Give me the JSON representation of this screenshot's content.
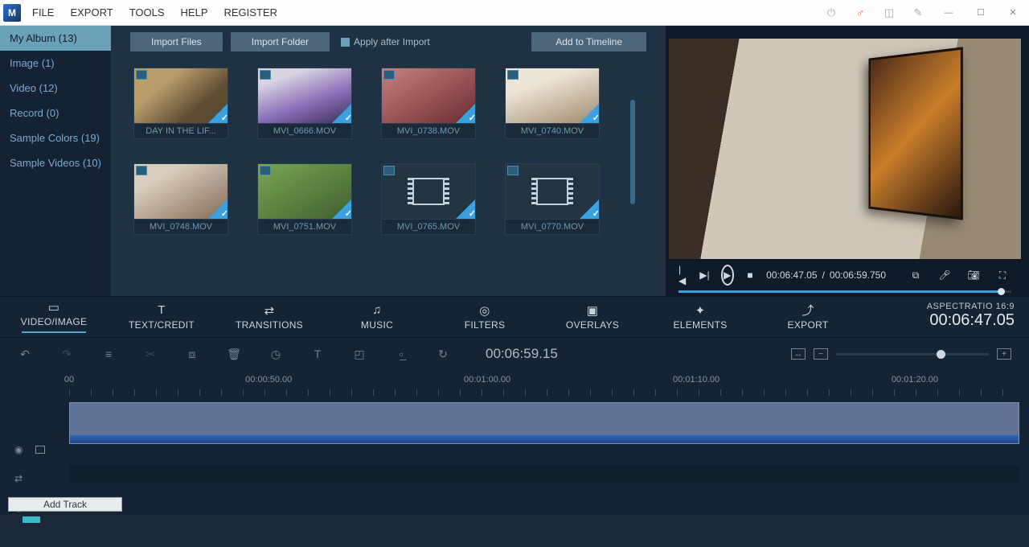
{
  "menu": {
    "file": "FILE",
    "export": "EXPORT",
    "tools": "TOOLS",
    "help": "HELP",
    "register": "REGISTER"
  },
  "sidebar": {
    "items": [
      {
        "label": "My Album (13)",
        "active": true
      },
      {
        "label": "Image (1)"
      },
      {
        "label": "Video (12)"
      },
      {
        "label": "Record (0)"
      },
      {
        "label": "Sample Colors (19)"
      },
      {
        "label": "Sample Videos (10)"
      }
    ]
  },
  "mediaToolbar": {
    "importFiles": "Import Files",
    "importFolder": "Import Folder",
    "applyAfter": "Apply after Import",
    "addTimeline": "Add to Timeline"
  },
  "thumbs": [
    {
      "label": "DAY IN THE LIF...",
      "cls": "t1"
    },
    {
      "label": "MVI_0666.MOV",
      "cls": "t2"
    },
    {
      "label": "MVI_0738.MOV",
      "cls": "t3"
    },
    {
      "label": "MVI_0740.MOV",
      "cls": "t4"
    },
    {
      "label": "MVI_0748.MOV",
      "cls": "t5"
    },
    {
      "label": "MVI_0751.MOV",
      "cls": "t6"
    },
    {
      "label": "MVI_0765.MOV",
      "cls": "generic"
    },
    {
      "label": "MVI_0770.MOV",
      "cls": "generic"
    }
  ],
  "preview": {
    "current": "00:06:47.05",
    "total": "00:06:59.750"
  },
  "tabs": [
    {
      "label": "VIDEO/IMAGE",
      "icon": "▭"
    },
    {
      "label": "TEXT/CREDIT",
      "icon": "T"
    },
    {
      "label": "TRANSITIONS",
      "icon": "⇄"
    },
    {
      "label": "MUSIC",
      "icon": "♫"
    },
    {
      "label": "FILTERS",
      "icon": "◎"
    },
    {
      "label": "OVERLAYS",
      "icon": "▣"
    },
    {
      "label": "ELEMENTS",
      "icon": "✦"
    },
    {
      "label": "EXPORT",
      "icon": "⤴"
    }
  ],
  "aspect": {
    "label": "ASPECTRATIO 16:9",
    "time": "00:06:47.05"
  },
  "toolbar2": {
    "time": "00:06:59.15"
  },
  "ruler": [
    "00",
    "00:00:50.00",
    "00:01:00.00",
    "00:01:10.00",
    "00:01:20.00"
  ],
  "addTrack": "Add Track"
}
